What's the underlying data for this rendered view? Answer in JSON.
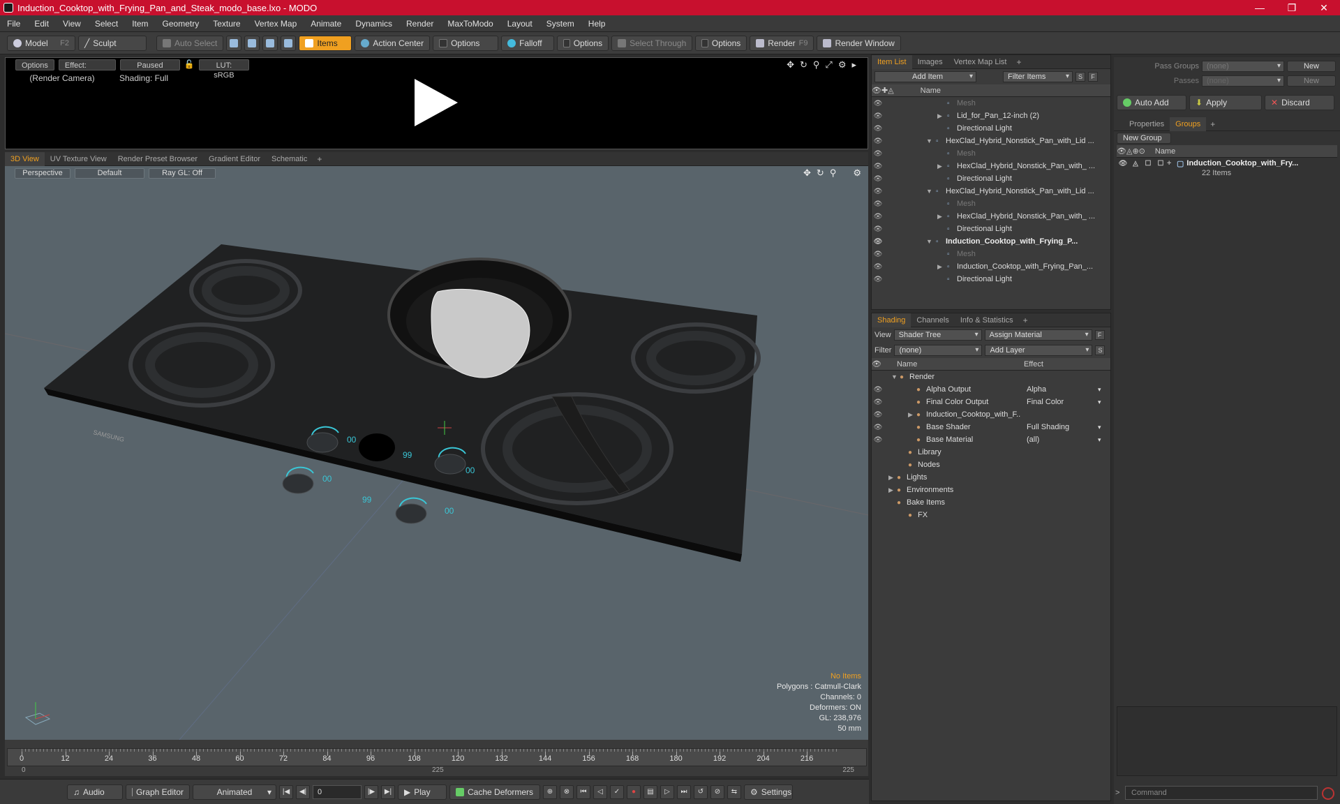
{
  "window": {
    "title": "Induction_Cooktop_with_Frying_Pan_and_Steak_modo_base.lxo - MODO",
    "controls": [
      "—",
      "❐",
      "✕"
    ]
  },
  "menu": [
    "File",
    "Edit",
    "View",
    "Select",
    "Item",
    "Geometry",
    "Texture",
    "Vertex Map",
    "Animate",
    "Dynamics",
    "Render",
    "MaxToModo",
    "Layout",
    "System",
    "Help"
  ],
  "toolbar": {
    "model": "Model",
    "model_key": "F2",
    "sculpt": "Sculpt",
    "auto_select": "Auto Select",
    "items": "Items",
    "action_center": "Action Center",
    "options1": "Options",
    "falloff": "Falloff",
    "options2": "Options",
    "select_through": "Select Through",
    "options3": "Options",
    "render": "Render",
    "render_key": "F9",
    "render_window": "Render Window"
  },
  "preview": {
    "options": "Options",
    "effect": "Effect: (Shadi...",
    "paused": "Paused",
    "lut": "LUT: sRGB",
    "camera": "(Render Camera)",
    "shading": "Shading: Full"
  },
  "viewport_tabs": [
    "3D View",
    "UV Texture View",
    "Render Preset Browser",
    "Gradient Editor",
    "Schematic"
  ],
  "viewport": {
    "mode": "Perspective",
    "style": "Default",
    "raygl": "Ray GL: Off",
    "brand": "SAMSUNG",
    "stats": {
      "no_items": "No Items",
      "polygons": "Polygons : Catmull-Clark",
      "channels": "Channels: 0",
      "deformers": "Deformers: ON",
      "gl": "GL: 238,976",
      "scale": "50 mm"
    },
    "readouts": [
      "00",
      "99",
      "00",
      "00",
      "99",
      "00"
    ]
  },
  "timeline": {
    "labels": [
      "0",
      "12",
      "24",
      "36",
      "48",
      "60",
      "72",
      "84",
      "96",
      "108",
      "120",
      "132",
      "144",
      "156",
      "168",
      "180",
      "192",
      "204",
      "216"
    ],
    "start": "0",
    "mid": "225",
    "end": "225"
  },
  "transport": {
    "audio": "Audio",
    "graph_editor": "Graph Editor",
    "animated": "Animated",
    "frame": "0",
    "play": "Play",
    "cache": "Cache Deformers",
    "settings": "Settings"
  },
  "item_list": {
    "tabs": [
      "Item List",
      "Images",
      "Vertex Map List"
    ],
    "add_item": "Add Item",
    "filter_items": "Filter Items",
    "col_name": "Name",
    "rows": [
      {
        "label": "Mesh",
        "indent": 94,
        "style": "dim",
        "arrow": ""
      },
      {
        "label": "Lid_for_Pan_12-inch (2)",
        "indent": 94,
        "style": "",
        "arrow": "▶"
      },
      {
        "label": "Directional Light",
        "indent": 94,
        "style": "",
        "arrow": ""
      },
      {
        "label": "HexClad_Hybrid_Nonstick_Pan_with_Lid ...",
        "indent": 78,
        "style": "",
        "arrow": "▼"
      },
      {
        "label": "Mesh",
        "indent": 94,
        "style": "dim",
        "arrow": ""
      },
      {
        "label": "HexClad_Hybrid_Nonstick_Pan_with_ ...",
        "indent": 94,
        "style": "",
        "arrow": "▶"
      },
      {
        "label": "Directional Light",
        "indent": 94,
        "style": "",
        "arrow": ""
      },
      {
        "label": "HexClad_Hybrid_Nonstick_Pan_with_Lid ...",
        "indent": 78,
        "style": "",
        "arrow": "▼"
      },
      {
        "label": "Mesh",
        "indent": 94,
        "style": "dim",
        "arrow": ""
      },
      {
        "label": "HexClad_Hybrid_Nonstick_Pan_with_ ...",
        "indent": 94,
        "style": "",
        "arrow": "▶"
      },
      {
        "label": "Directional Light",
        "indent": 94,
        "style": "",
        "arrow": ""
      },
      {
        "label": "Induction_Cooktop_with_Frying_P...",
        "indent": 78,
        "style": "bold",
        "arrow": "▼"
      },
      {
        "label": "Mesh",
        "indent": 94,
        "style": "dim",
        "arrow": ""
      },
      {
        "label": "Induction_Cooktop_with_Frying_Pan_...",
        "indent": 94,
        "style": "",
        "arrow": "▶"
      },
      {
        "label": "Directional Light",
        "indent": 94,
        "style": "",
        "arrow": ""
      }
    ]
  },
  "shading": {
    "tabs": [
      "Shading",
      "Channels",
      "Info & Statistics"
    ],
    "view_label": "View",
    "view_value": "Shader Tree",
    "assign_material": "Assign Material",
    "filter_label": "Filter",
    "filter_value": "(none)",
    "add_layer": "Add Layer",
    "col_name": "Name",
    "col_effect": "Effect",
    "rows": [
      {
        "label": "Render",
        "effect": "",
        "indent": 40,
        "arrow": "▼"
      },
      {
        "label": "Alpha Output",
        "effect": "Alpha",
        "indent": 64,
        "arrow": ""
      },
      {
        "label": "Final Color Output",
        "effect": "Final Color",
        "indent": 64,
        "arrow": ""
      },
      {
        "label": "Induction_Cooktop_with_F...",
        "effect": "",
        "indent": 64,
        "arrow": "▶"
      },
      {
        "label": "Base Shader",
        "effect": "Full Shading",
        "indent": 64,
        "arrow": ""
      },
      {
        "label": "Base Material",
        "effect": "(all)",
        "indent": 64,
        "arrow": ""
      },
      {
        "label": "Library",
        "effect": "",
        "indent": 52,
        "arrow": ""
      },
      {
        "label": "Nodes",
        "effect": "",
        "indent": 52,
        "arrow": ""
      },
      {
        "label": "Lights",
        "effect": "",
        "indent": 36,
        "arrow": "▶"
      },
      {
        "label": "Environments",
        "effect": "",
        "indent": 36,
        "arrow": "▶"
      },
      {
        "label": "Bake Items",
        "effect": "",
        "indent": 36,
        "arrow": ""
      },
      {
        "label": "FX",
        "effect": "",
        "indent": 52,
        "arrow": ""
      }
    ]
  },
  "passes": {
    "pass_groups": "Pass Groups",
    "pass_groups_value": "(none)",
    "new1": "New",
    "passes": "Passes",
    "passes_value": "(none)",
    "new2": "New",
    "auto_add": "Auto Add",
    "apply": "Apply",
    "discard": "Discard"
  },
  "groups": {
    "tabs": [
      "Properties",
      "Groups"
    ],
    "new_group": "New Group",
    "col_name": "Name",
    "item_name": "Induction_Cooktop_with_Fry...",
    "item_count": "22 Items"
  },
  "command": {
    "placeholder": "Command"
  },
  "colors": {
    "accent": "#f0a020",
    "title": "#c8102e",
    "viewport": "#59646b"
  }
}
